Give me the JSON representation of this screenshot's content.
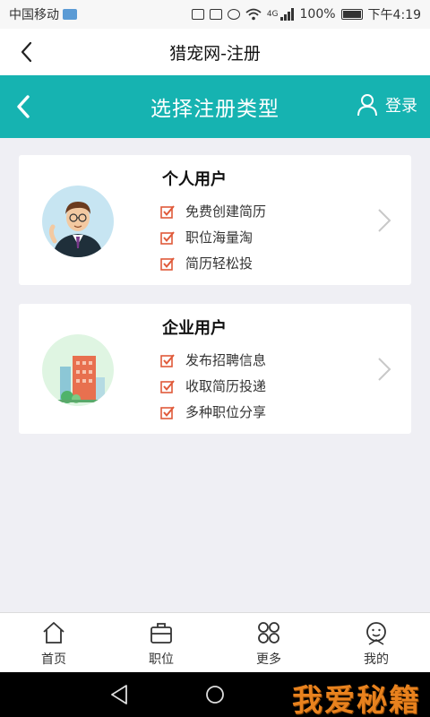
{
  "status_bar": {
    "carrier": "中国移动",
    "network": "4G",
    "battery": "100%",
    "time": "下午4:19"
  },
  "webview": {
    "title": "猎宠网-注册"
  },
  "header": {
    "title": "选择注册类型",
    "login_label": "登录"
  },
  "cards": {
    "personal": {
      "title": "个人用户",
      "features": [
        "免费创建简历",
        "职位海量淘",
        "简历轻松投"
      ]
    },
    "enterprise": {
      "title": "企业用户",
      "features": [
        "发布招聘信息",
        "收取简历投递",
        "多种职位分享"
      ]
    }
  },
  "bottom_nav": {
    "items": [
      {
        "label": "首页",
        "icon": "home-icon"
      },
      {
        "label": "职位",
        "icon": "briefcase-icon"
      },
      {
        "label": "更多",
        "icon": "grid-icon"
      },
      {
        "label": "我的",
        "icon": "profile-icon"
      }
    ]
  },
  "watermark": "我爱秘籍",
  "colors": {
    "accent": "#16b3b1",
    "check": "#e05a3a",
    "background": "#efeff4",
    "watermark": "#e8821e"
  }
}
